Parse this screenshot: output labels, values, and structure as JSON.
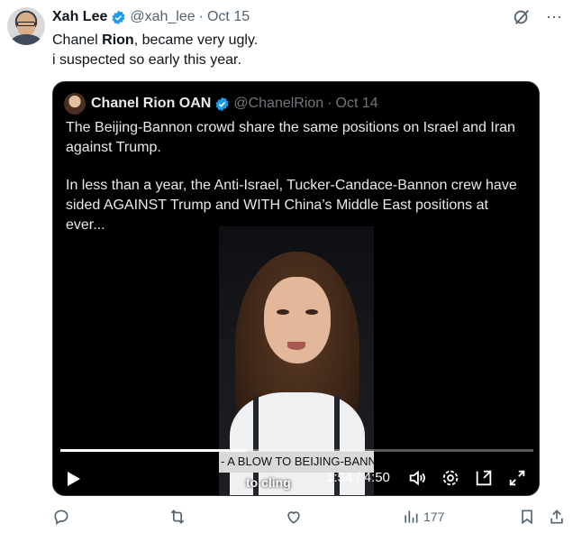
{
  "tweet": {
    "author_name": "Xah Lee",
    "handle": "@xah_lee",
    "separator": "·",
    "date": "Oct 15",
    "text_line1_prefix": "Chanel ",
    "text_line1_bold": "Rion",
    "text_line1_suffix": ", became very ugly.",
    "text_line2": "i suspected so early this year."
  },
  "quote": {
    "author_name": "Chanel Rion OAN",
    "handle": "@ChanelRion",
    "separator": "·",
    "date": "Oct 14",
    "paragraph1": "The Beijing-Bannon crowd share the same positions on Israel and Iran against Trump.",
    "paragraph2": "In less than a year, the Anti-Israel, Tucker-Candace-Bannon crew have sided AGAINST Trump and WITH China’s Middle East positions at ever...",
    "video": {
      "caption": "to cling",
      "lower_third": "- A BLOW TO BEIJING-BANNON",
      "time": "1:54 / 4:50",
      "progress": 0.393
    }
  },
  "actions": {
    "views": "177"
  },
  "icons": {
    "top": [
      "grok-icon",
      "more-icon"
    ],
    "actions": [
      "reply-icon",
      "retweet-icon",
      "like-icon",
      "views-icon",
      "bookmark-icon",
      "share-icon"
    ],
    "video": [
      "play-icon",
      "volume-icon",
      "settings-icon",
      "picture-in-picture-icon",
      "fullscreen-icon"
    ]
  },
  "colors": {
    "verified": "#1d9bf0",
    "muted": "#536471",
    "quote_bg": "#000000"
  }
}
